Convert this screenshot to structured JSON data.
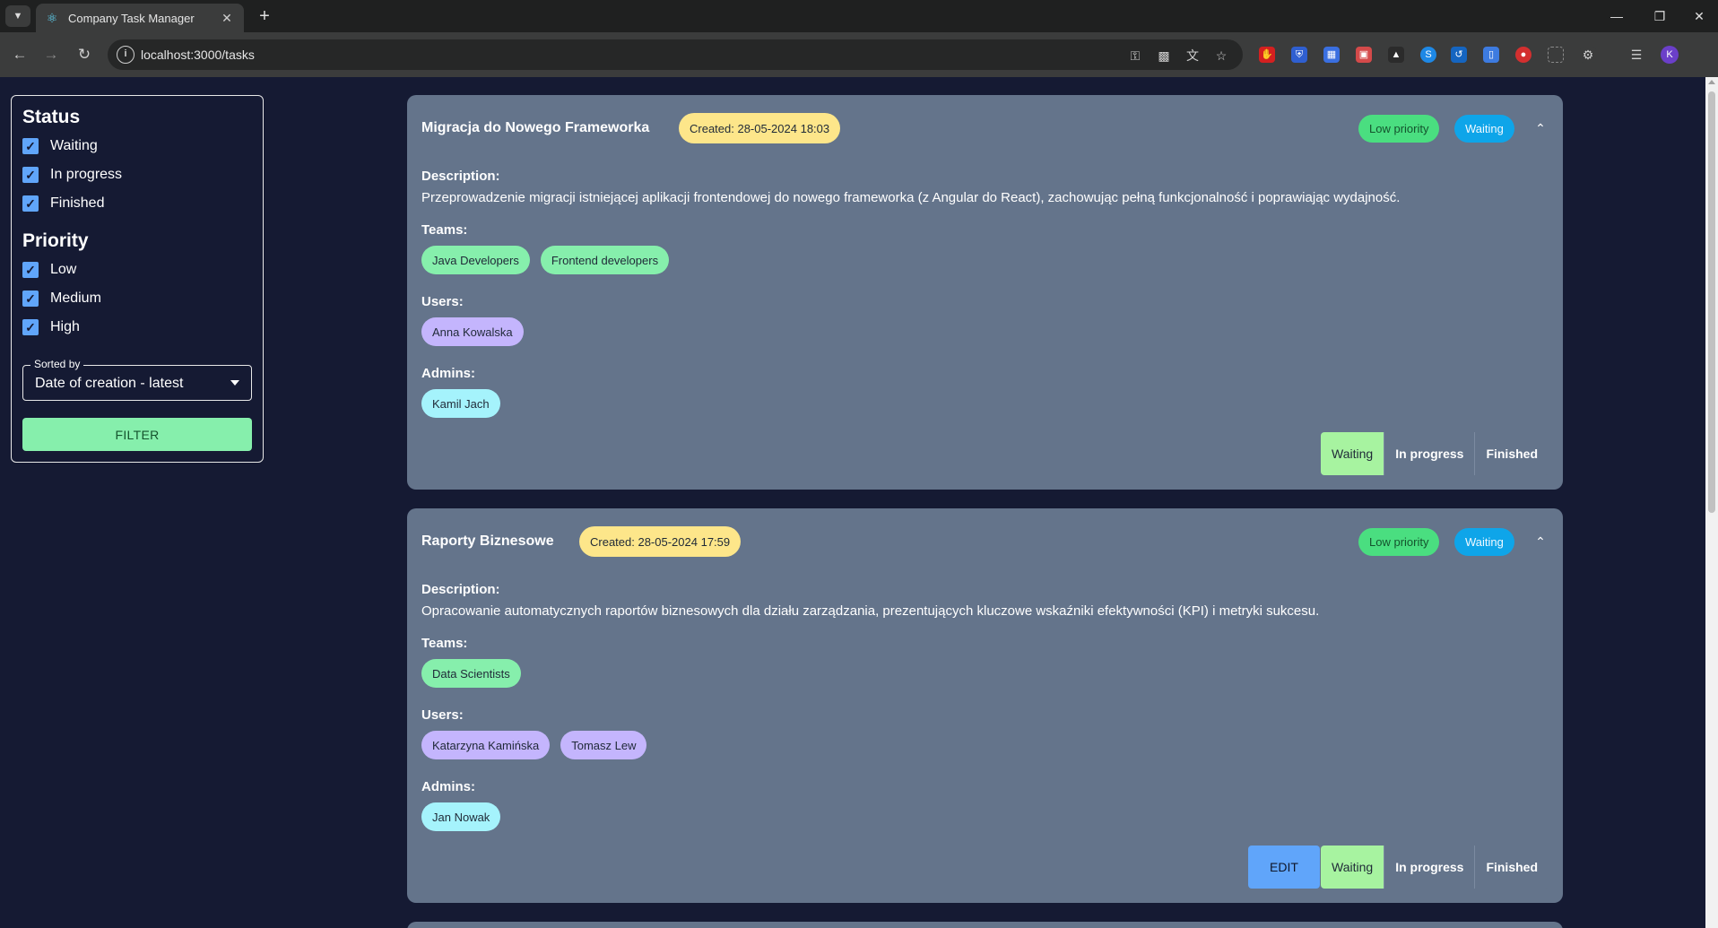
{
  "browser": {
    "tab_title": "Company Task Manager",
    "url": "localhost:3000/tasks",
    "profile_initial": "K"
  },
  "filter": {
    "status_title": "Status",
    "status_options": [
      "Waiting",
      "In progress",
      "Finished"
    ],
    "priority_title": "Priority",
    "priority_options": [
      "Low",
      "Medium",
      "High"
    ],
    "sort_label": "Sorted by",
    "sort_value": "Date of creation - latest",
    "filter_button": "FILTER"
  },
  "tasks": [
    {
      "title": "Migracja do Nowego Frameworka",
      "created": "Created: 28-05-2024 18:03",
      "priority": "Low priority",
      "status": "Waiting",
      "description_label": "Description:",
      "description": "Przeprowadzenie migracji istniejącej aplikacji frontendowej do nowego frameworka (z Angular do React), zachowując pełną funkcjonalność i poprawiając wydajność.",
      "teams_label": "Teams:",
      "teams": [
        "Java Developers",
        "Frontend developers"
      ],
      "users_label": "Users:",
      "users": [
        "Anna Kowalska"
      ],
      "admins_label": "Admins:",
      "admins": [
        "Kamil Jach"
      ],
      "status_buttons": [
        "Waiting",
        "In progress",
        "Finished"
      ]
    },
    {
      "title": "Raporty Biznesowe",
      "created": "Created: 28-05-2024 17:59",
      "priority": "Low priority",
      "status": "Waiting",
      "description_label": "Description:",
      "description": "Opracowanie automatycznych raportów biznesowych dla działu zarządzania, prezentujących kluczowe wskaźniki efektywności (KPI) i metryki sukcesu.",
      "teams_label": "Teams:",
      "teams": [
        "Data Scientists"
      ],
      "users_label": "Users:",
      "users": [
        "Katarzyna Kamińska",
        "Tomasz Lew"
      ],
      "admins_label": "Admins:",
      "admins": [
        "Jan Nowak"
      ],
      "edit_button": "EDIT",
      "status_buttons": [
        "Waiting",
        "In progress",
        "Finished"
      ]
    }
  ]
}
